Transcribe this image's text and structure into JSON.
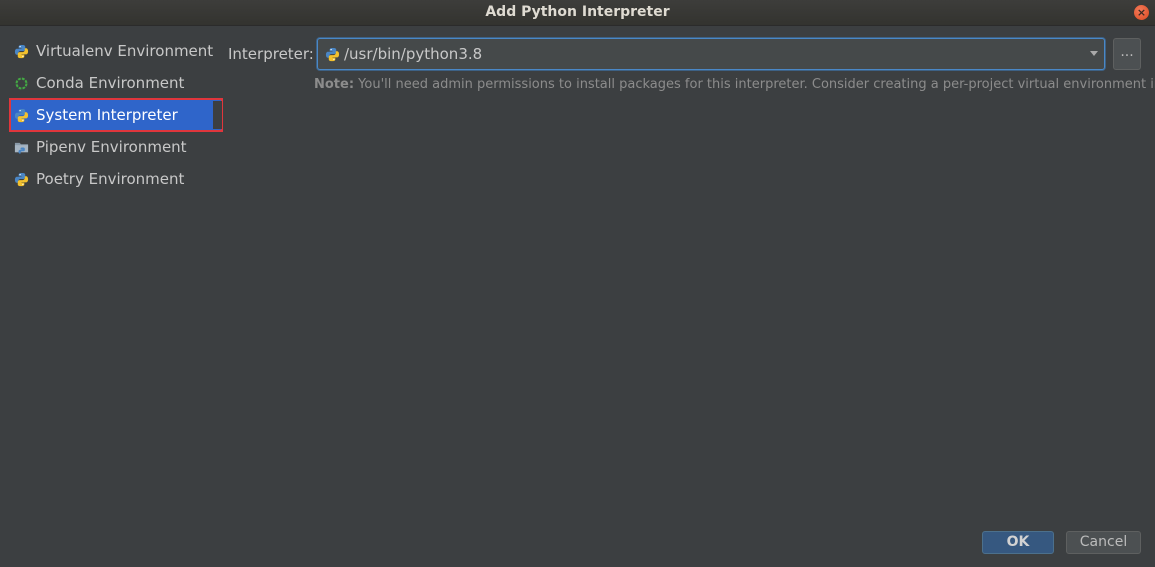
{
  "window": {
    "title": "Add Python Interpreter",
    "close_glyph": "×"
  },
  "sidebar": {
    "items": [
      {
        "label": "Virtualenv Environment",
        "icon": "python-icon"
      },
      {
        "label": "Conda Environment",
        "icon": "conda-icon"
      },
      {
        "label": "System Interpreter",
        "icon": "python-icon",
        "selected": true
      },
      {
        "label": "Pipenv Environment",
        "icon": "pipenv-icon"
      },
      {
        "label": "Poetry Environment",
        "icon": "python-icon"
      }
    ]
  },
  "interpreter": {
    "label": "Interpreter:",
    "value": "/usr/bin/python3.8",
    "browse_label": "..."
  },
  "note": {
    "prefix": "Note:",
    "text": " You'll need admin permissions to install packages for this interpreter. Consider creating a per-project virtual environment instead."
  },
  "buttons": {
    "ok": "OK",
    "cancel": "Cancel"
  },
  "colors": {
    "background": "#3c3f41",
    "selection": "#2f65ca",
    "highlight_border": "#e0363c",
    "focus_border": "#4a88c7",
    "ok_button": "#365880"
  }
}
